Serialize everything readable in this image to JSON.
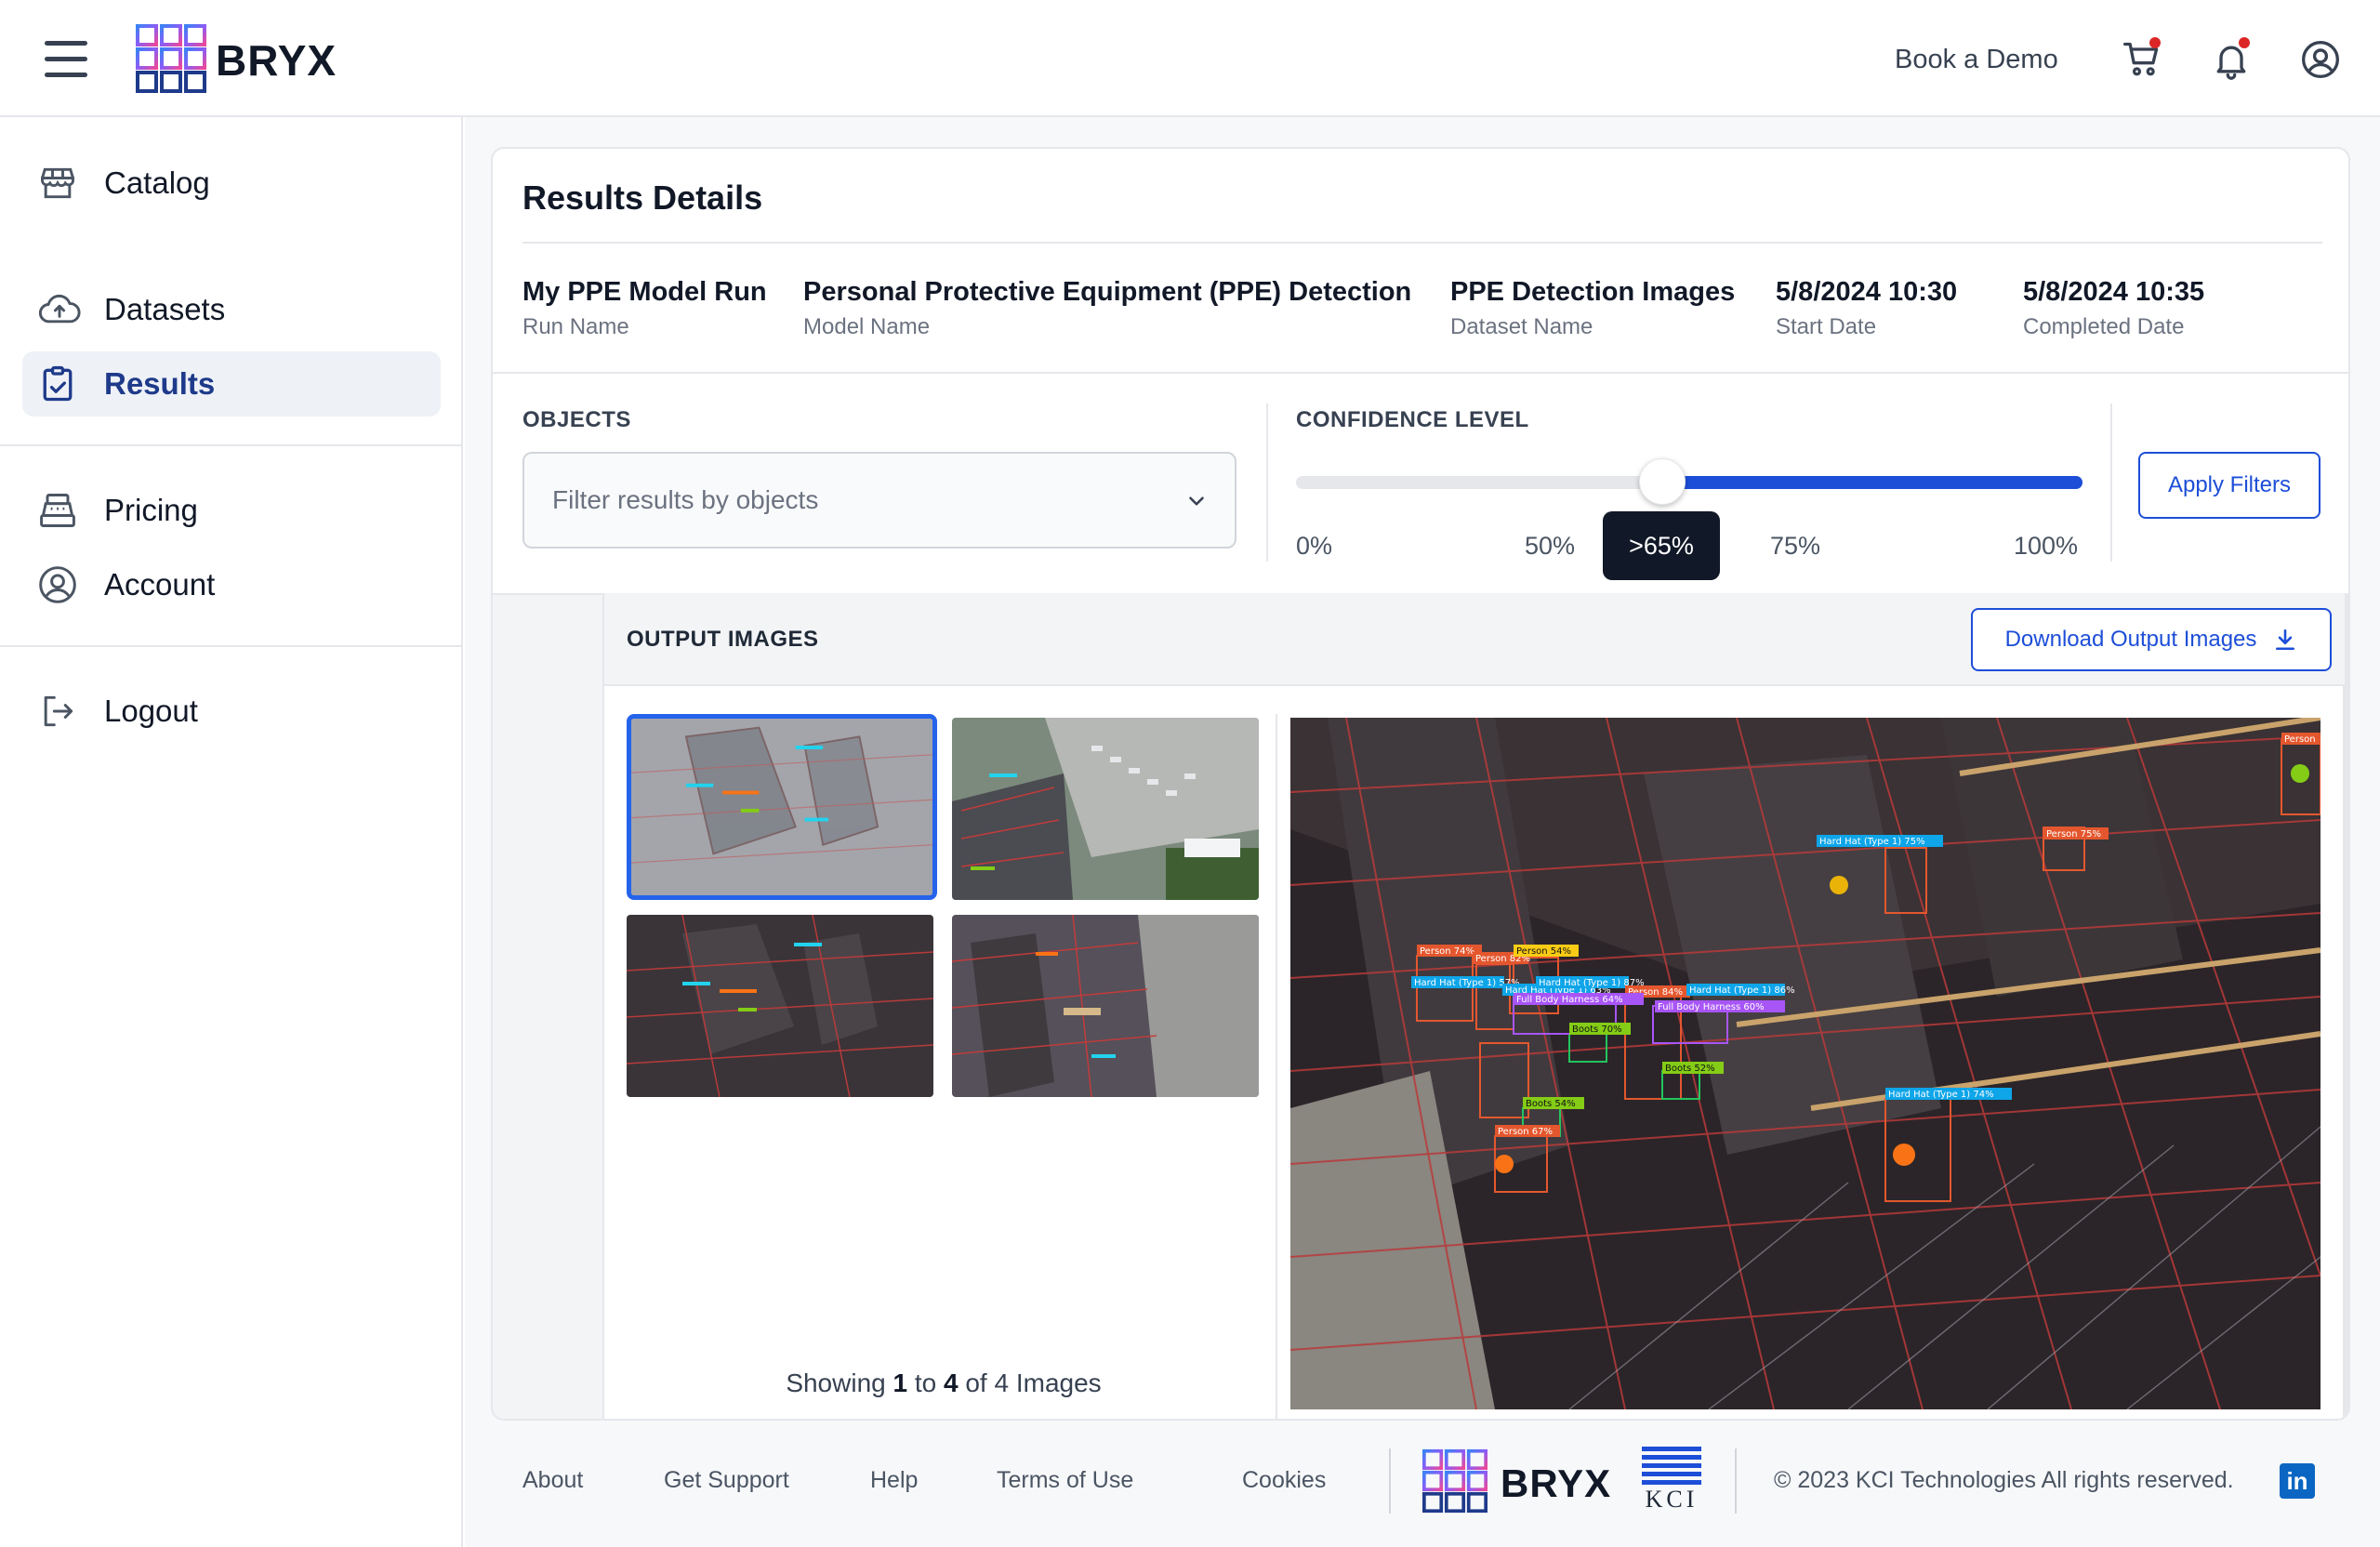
{
  "header": {
    "brand": "BRYX",
    "book_demo": "Book a Demo"
  },
  "sidebar": {
    "items": [
      {
        "label": "Catalog",
        "icon": "store-icon"
      },
      {
        "label": "Datasets",
        "icon": "cloud-upload-icon"
      },
      {
        "label": "Results",
        "icon": "clipboard-check-icon",
        "active": true
      },
      {
        "label": "Pricing",
        "icon": "cash-register-icon"
      },
      {
        "label": "Account",
        "icon": "user-circle-icon"
      },
      {
        "label": "Logout",
        "icon": "logout-icon"
      }
    ]
  },
  "results": {
    "title": "Results Details",
    "meta": [
      {
        "value": "My PPE Model Run",
        "label": "Run Name"
      },
      {
        "value": "Personal Protective Equipment (PPE) Detection",
        "label": "Model Name"
      },
      {
        "value": "PPE Detection Images",
        "label": "Dataset Name"
      },
      {
        "value": "5/8/2024 10:30",
        "label": "Start Date"
      },
      {
        "value": "5/8/2024 10:35",
        "label": "Completed Date"
      }
    ]
  },
  "filters": {
    "objects_label": "OBJECTS",
    "objects_placeholder": "Filter results by objects",
    "confidence_label": "CONFIDENCE LEVEL",
    "confidence_value": 0.65,
    "ticks": [
      "0%",
      "50%",
      ">65%",
      "75%",
      "100%"
    ],
    "apply": "Apply Filters"
  },
  "output": {
    "title": "OUTPUT IMAGES",
    "download": "Download Output Images",
    "showing_prefix": "Showing",
    "from": "1",
    "to_word": "to",
    "to": "4",
    "of_word": "of",
    "total": "4",
    "suffix": "Images",
    "detections": [
      "Person 74%",
      "Person 82%",
      "Person 54%",
      "Hard Hat (Type 1) 57%",
      "Hard Hat (Type 1) 63%",
      "Hard Hat (Type 1) 87%",
      "Person 84%",
      "Hard Hat (Type 1) 86%",
      "Full Body Harness 64%",
      "Full Body Harness 60%",
      "Boots 70%",
      "Boots 52%",
      "Boots 54%",
      "Person 67%",
      "Hard Hat (Type 1) 75%",
      "Person 75%",
      "Hard Hat (Type 1) 74%",
      "Person"
    ]
  },
  "footer": {
    "links": [
      "About",
      "Get Support",
      "Help",
      "Terms of Use",
      "Cookies"
    ],
    "brand": "BRYX",
    "partner": "KCI",
    "copyright": "© 2023 KCI Technologies All rights reserved.",
    "social": "in"
  },
  "colors": {
    "accent": "#1d4ed8",
    "brand_navy": "#1e3a8a",
    "tooltip": "#111827"
  }
}
